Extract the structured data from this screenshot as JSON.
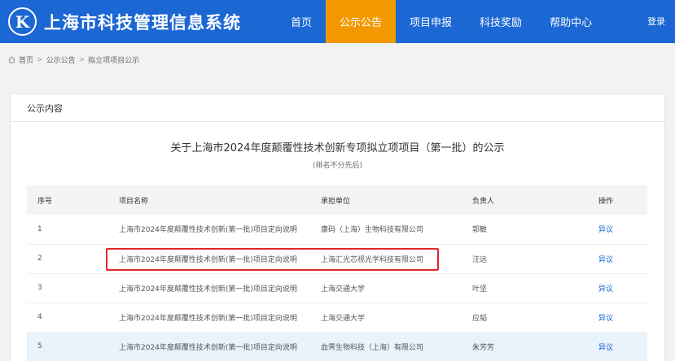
{
  "header": {
    "logo_letter": "K",
    "site_title": "上海市科技管理信息系统",
    "nav": [
      "首页",
      "公示公告",
      "项目申报",
      "科技奖励",
      "帮助中心"
    ],
    "active_nav": 1,
    "login": "登录",
    "brand_color": "#1b67d3",
    "accent_color": "#f39800"
  },
  "breadcrumb": [
    "首页",
    "公示公告",
    "拟立项项目公示"
  ],
  "panel": {
    "head": "公示内容",
    "title": "关于上海市2024年度颠覆性技术创新专项拟立项项目（第一批）的公示",
    "subtitle": "(排名不分先后)"
  },
  "table": {
    "headers": [
      "序号",
      "项目名称",
      "承担单位",
      "负责人",
      "操作"
    ],
    "rows": [
      [
        "1",
        "上海市2024年度颠覆性技术创新(第一批)项目定向说明",
        "康码（上海）生物科技有限公司",
        "郭敏",
        "异议"
      ],
      [
        "2",
        "上海市2024年度颠覆性技术创新(第一批)项目定向说明",
        "上海汇光芯视光学科技有限公司",
        "汪远",
        "异议"
      ],
      [
        "3",
        "上海市2024年度颠覆性技术创新(第一批)项目定向说明",
        "上海交通大学",
        "叶坚",
        "异议"
      ],
      [
        "4",
        "上海市2024年度颠覆性技术创新(第一批)项目定向说明",
        "上海交通大学",
        "应韬",
        "异议"
      ],
      [
        "5",
        "上海市2024年度颠覆性技术创新(第一批)项目定向说明",
        "血霁生物科技（上海）有限公司",
        "朱芳芳",
        "异议"
      ]
    ]
  }
}
